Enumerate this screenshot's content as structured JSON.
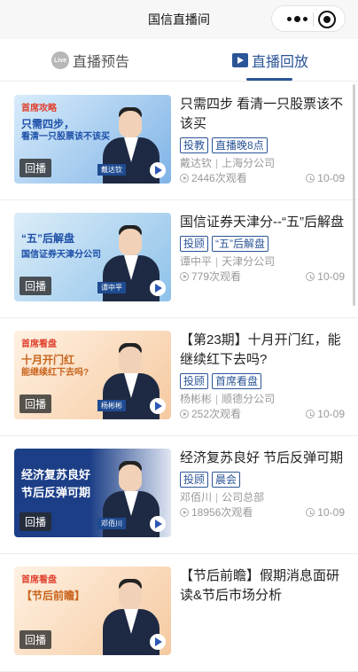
{
  "topbar": {
    "title": "国信直播间"
  },
  "tabs": [
    {
      "label": "直播预告",
      "icon_text": "Live"
    },
    {
      "label": "直播回放"
    }
  ],
  "replay_badge": "回播",
  "items": [
    {
      "title": "只需四步 看清一只股票该不该买",
      "tags": [
        "投教",
        "直播晚8点"
      ],
      "author": "戴达钦",
      "branch": "上海分公司",
      "views": "2446次观看",
      "date": "10-09",
      "thumb": {
        "top": "首席攻略",
        "line1": "只需四步，",
        "line2": "看清一只股票该不该买",
        "name": "戴达钦"
      },
      "colors": {
        "bg1": "#d8ecfb",
        "bg2": "#7fb3e6"
      }
    },
    {
      "title": "国信证券天津分--“五”后解盘",
      "tags": [
        "投顾",
        "“五”后解盘"
      ],
      "author": "谭中平",
      "branch": "天津分公司",
      "views": "779次观看",
      "date": "10-09",
      "thumb": {
        "top": "",
        "line1": "“五”后解盘",
        "line2": "国信证券天津分公司",
        "name": "谭中平"
      },
      "colors": {
        "bg1": "#dcedf8",
        "bg2": "#8ec2ea"
      }
    },
    {
      "title": "【第23期】十月开门红，能继续红下去吗?",
      "tags": [
        "投顾",
        "首席看盘"
      ],
      "author": "杨彬彬",
      "branch": "顺德分公司",
      "views": "252次观看",
      "date": "10-09",
      "thumb": {
        "top": "首席看盘",
        "line1": "十月开门红",
        "line2": "能继续红下去吗?",
        "name": "杨彬彬"
      },
      "colors": {
        "bg1": "#fff1e2",
        "bg2": "#f5c9a0"
      }
    },
    {
      "title": "经济复苏良好 节后反弹可期",
      "tags": [
        "投顾",
        "晨会"
      ],
      "author": "邓佰川",
      "branch": "公司总部",
      "views": "18956次观看",
      "date": "10-09",
      "thumb": {
        "top": "",
        "line1": "经济复苏良好",
        "line2": "节后反弹可期",
        "name": "邓佰川"
      },
      "colors": {
        "bg1": "#1b3e86",
        "bg2": "#dfe6f3"
      }
    },
    {
      "title": "【节后前瞻】假期消息面研读&节后市场分析",
      "tags": [],
      "author": "",
      "branch": "",
      "views": "",
      "date": "",
      "thumb": {
        "top": "首席看盘",
        "line1": "【节后前瞻】",
        "line2": "",
        "name": ""
      },
      "colors": {
        "bg1": "#fff1e2",
        "bg2": "#f5c9a0"
      }
    }
  ]
}
